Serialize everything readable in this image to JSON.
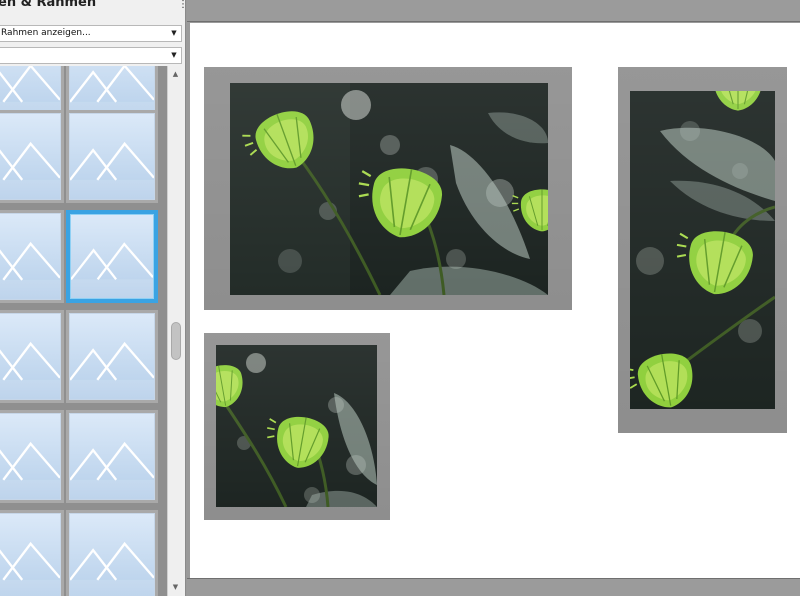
{
  "panel": {
    "title": "en & Rahmen",
    "menu_glyph": "⋮",
    "dropdown_primary": {
      "value": "Rahmen anzeigen..."
    },
    "dropdown_secondary": {
      "value": ""
    },
    "dropdown_arrow": "▼",
    "scroll_up": "▲",
    "scroll_down": "▼"
  },
  "frame_presets": [
    {
      "label": "",
      "selected": false
    },
    {
      "label": "",
      "selected": false
    },
    {
      "label": "",
      "selected": false
    },
    {
      "label": "",
      "selected": false
    },
    {
      "label": "",
      "selected": false
    },
    {
      "label": "",
      "selected": true
    },
    {
      "label": "",
      "selected": false
    },
    {
      "label": "",
      "selected": false
    },
    {
      "label": "",
      "selected": false
    },
    {
      "label": "",
      "selected": false
    },
    {
      "label": "",
      "selected": false
    },
    {
      "label": "",
      "selected": false
    }
  ],
  "colors": {
    "panel_bg": "#f0f0f0",
    "selection": "#3aa3e3",
    "frame_gray": "#8e8e8e",
    "page_bg": "#ffffff",
    "leaf_green": "#7fbf3a"
  },
  "canvas": {
    "photos": [
      {
        "name": "photo-landscape-large",
        "subject": "green-seed-pods"
      },
      {
        "name": "photo-portrait-right",
        "subject": "green-seed-pods"
      },
      {
        "name": "photo-square-small",
        "subject": "green-seed-pods"
      }
    ]
  }
}
